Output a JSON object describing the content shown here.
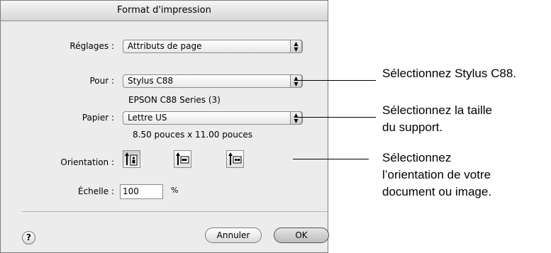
{
  "dialog": {
    "title": "Format d'impression",
    "settings": {
      "label": "Réglages :",
      "value": "Attributs de page"
    },
    "printer": {
      "label": "Pour :",
      "value": "Stylus C88",
      "subtitle": "EPSON C88 Series (3)"
    },
    "paper": {
      "label": "Papier :",
      "value": "Lettre US",
      "subtitle": "8.50 pouces x 11.00 pouces"
    },
    "orientation": {
      "label": "Orientation :",
      "selected": "portrait"
    },
    "scale": {
      "label": "Échelle :",
      "value": "100",
      "unit": "%"
    },
    "help_label": "?",
    "cancel_label": "Annuler",
    "ok_label": "OK"
  },
  "callouts": {
    "printer_prefix": "Sélectionnez ",
    "printer_bold": "Stylus C88",
    "printer_suffix": ".",
    "paper_line1": "Sélectionnez la taille",
    "paper_line2": "du support.",
    "orientation_line1": "Sélectionnez",
    "orientation_line2": "l’orientation de votre",
    "orientation_line3": "document ou image."
  }
}
